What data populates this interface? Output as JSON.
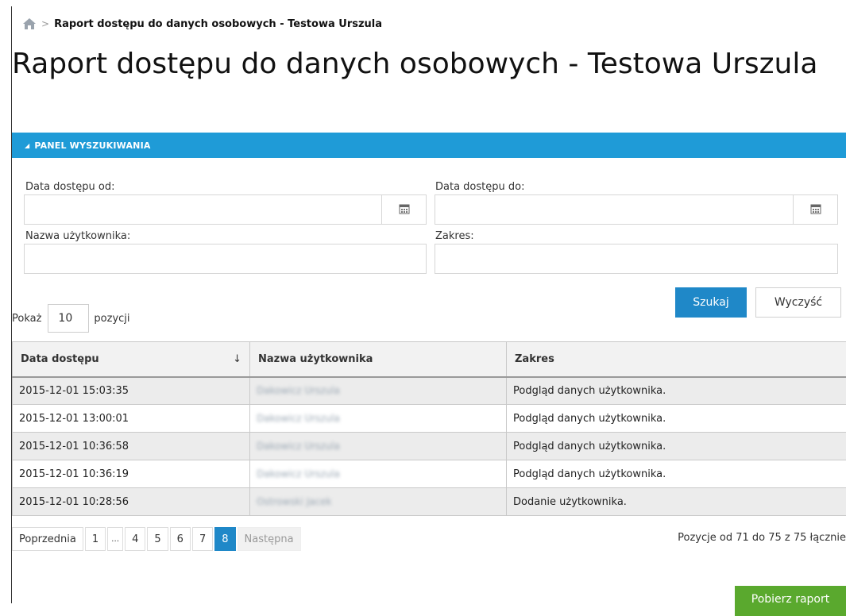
{
  "breadcrumb": {
    "home_icon": "home-icon",
    "separator": ">",
    "current": "Raport dostępu do danych osobowych - Testowa Urszula"
  },
  "page": {
    "title": "Raport dostępu do danych osobowych - Testowa Urszula"
  },
  "panel": {
    "title": "PANEL WYSZUKIWANIA",
    "toggle_icon": "triangle-collapse-icon",
    "color": "#1f9bd7"
  },
  "filters": {
    "date_from_label": "Data dostępu od:",
    "date_from_value": "",
    "date_to_label": "Data dostępu do:",
    "date_to_value": "",
    "username_label": "Nazwa użytkownika:",
    "username_value": "",
    "scope_label": "Zakres:",
    "scope_value": "",
    "calendar_icon": "calendar-icon"
  },
  "actions": {
    "search_label": "Szukaj",
    "clear_label": "Wyczyść",
    "download_label": "Pobierz raport"
  },
  "page_size": {
    "prefix": "Pokaż",
    "value": "10",
    "suffix": "pozycji"
  },
  "table": {
    "columns": [
      "Data dostępu",
      "Nazwa użytkownika",
      "Zakres"
    ],
    "sort_indicator": "↓",
    "rows": [
      {
        "date": "2015-12-01 15:03:35",
        "user": "Dakowicz Urszula",
        "scope": "Podgląd danych użytkownika."
      },
      {
        "date": "2015-12-01 13:00:01",
        "user": "Dakowicz Urszula",
        "scope": "Podgląd danych użytkownika."
      },
      {
        "date": "2015-12-01 10:36:58",
        "user": "Dakowicz Urszula",
        "scope": "Podgląd danych użytkownika."
      },
      {
        "date": "2015-12-01 10:36:19",
        "user": "Dakowicz Urszula",
        "scope": "Podgląd danych użytkownika."
      },
      {
        "date": "2015-12-01 10:28:56",
        "user": "Ostrowski Jacek",
        "scope": "Dodanie użytkownika."
      }
    ]
  },
  "pagination": {
    "prev": "Poprzednia",
    "pages": [
      "1",
      "…",
      "4",
      "5",
      "6",
      "7",
      "8"
    ],
    "active": "8",
    "next": "Następna",
    "info": "Pozycje od 71 do 75 z 75 łącznie"
  },
  "colors": {
    "primary": "#1f88c8",
    "success": "#5aa92e"
  }
}
